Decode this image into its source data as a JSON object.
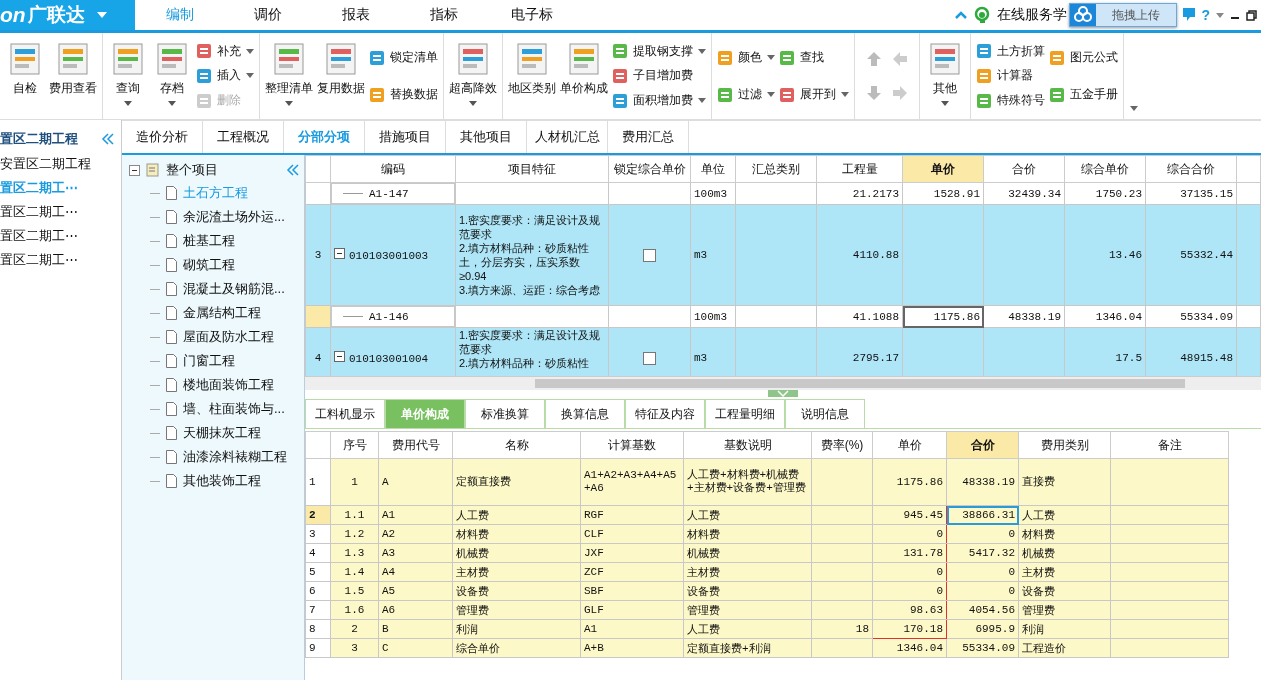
{
  "app_menu": {
    "prefix": "on",
    "brand": "广联达"
  },
  "menu_tabs": [
    {
      "label": "编制",
      "selected": true
    },
    {
      "label": "调价",
      "selected": false
    },
    {
      "label": "报表",
      "selected": false
    },
    {
      "label": "指标",
      "selected": false
    },
    {
      "label": "电子标",
      "selected": false
    }
  ],
  "online_service": "在线服务学",
  "upload_button": "拖拽上传",
  "help": "?",
  "ribbon": [
    {
      "kind": "buttons",
      "items": [
        {
          "kind": "large",
          "label": "自检",
          "dropdown": false,
          "disabled": false
        },
        {
          "kind": "large",
          "label": "费用查看",
          "dropdown": false,
          "disabled": false
        }
      ]
    },
    {
      "kind": "buttons",
      "items": [
        {
          "kind": "large",
          "label": "查询",
          "dropdown": true,
          "disabled": false
        },
        {
          "kind": "large",
          "label": "存档",
          "dropdown": true,
          "disabled": false
        },
        {
          "kind": "stack",
          "items": [
            {
              "label": "补充",
              "dropdown": true,
              "disabled": false
            },
            {
              "label": "插入",
              "dropdown": true,
              "disabled": false
            },
            {
              "label": "删除",
              "dropdown": false,
              "disabled": true
            }
          ]
        }
      ]
    },
    {
      "kind": "buttons",
      "items": [
        {
          "kind": "large",
          "label": "整理清单",
          "dropdown": true,
          "disabled": false
        },
        {
          "kind": "large",
          "label": "复用数据",
          "dropdown": false,
          "disabled": false
        },
        {
          "kind": "stack",
          "items": [
            {
              "label": "锁定清单",
              "dropdown": false,
              "disabled": false
            },
            {
              "label": "替换数据",
              "dropdown": false,
              "disabled": false
            }
          ]
        }
      ]
    },
    {
      "kind": "buttons",
      "items": [
        {
          "kind": "large",
          "label": "超高降效",
          "dropdown": true,
          "disabled": false
        }
      ]
    },
    {
      "kind": "buttons",
      "items": [
        {
          "kind": "large",
          "label": "地区类别",
          "dropdown": false,
          "disabled": false
        },
        {
          "kind": "large",
          "label": "单价构成",
          "dropdown": false,
          "disabled": false
        },
        {
          "kind": "stack",
          "items": [
            {
              "label": "提取钢支撑",
              "dropdown": true,
              "disabled": false
            },
            {
              "label": "子目增加费",
              "dropdown": false,
              "disabled": false
            },
            {
              "label": "面积增加费",
              "dropdown": true,
              "disabled": false
            }
          ]
        }
      ]
    },
    {
      "kind": "buttons",
      "items": [
        {
          "kind": "stack",
          "items": [
            {
              "label": "颜色",
              "dropdown": true,
              "disabled": false
            },
            {
              "label": "过滤",
              "dropdown": true,
              "disabled": false
            }
          ]
        },
        {
          "kind": "stack",
          "items": [
            {
              "label": "查找",
              "dropdown": false,
              "disabled": false
            },
            {
              "label": "展开到",
              "dropdown": true,
              "disabled": false
            }
          ]
        }
      ]
    },
    {
      "kind": "arrows"
    },
    {
      "kind": "buttons",
      "items": [
        {
          "kind": "large",
          "label": "其他",
          "dropdown": true,
          "disabled": false
        }
      ]
    },
    {
      "kind": "buttons",
      "items": [
        {
          "kind": "stack",
          "items": [
            {
              "label": "土方折算",
              "dropdown": false,
              "disabled": false
            },
            {
              "label": "计算器",
              "dropdown": false,
              "disabled": false
            },
            {
              "label": "特殊符号",
              "dropdown": false,
              "disabled": false
            }
          ]
        },
        {
          "kind": "stack",
          "items": [
            {
              "label": "图元公式",
              "dropdown": false,
              "disabled": false
            },
            {
              "label": "五金手册",
              "dropdown": false,
              "disabled": false
            }
          ]
        }
      ]
    }
  ],
  "projects": {
    "title": "置区二期工程",
    "items": [
      {
        "label": "安置区二期工程",
        "selected": false
      },
      {
        "label": "置区二期工⋯",
        "selected": true
      },
      {
        "label": "置区二期工⋯",
        "selected": false
      },
      {
        "label": "置区二期工⋯",
        "selected": false
      },
      {
        "label": "置区二期工⋯",
        "selected": false
      }
    ]
  },
  "main_tabs": [
    {
      "label": "造价分析",
      "selected": false
    },
    {
      "label": "工程概况",
      "selected": false
    },
    {
      "label": "分部分项",
      "selected": true
    },
    {
      "label": "措施项目",
      "selected": false
    },
    {
      "label": "其他项目",
      "selected": false
    },
    {
      "label": "人材机汇总",
      "selected": false
    },
    {
      "label": "费用汇总",
      "selected": false
    }
  ],
  "tree": {
    "label": "整个项目",
    "expanded": true,
    "children": [
      {
        "label": "土石方工程",
        "selected": true
      },
      {
        "label": "余泥渣土场外运...",
        "selected": false
      },
      {
        "label": "桩基工程",
        "selected": false
      },
      {
        "label": "砌筑工程",
        "selected": false
      },
      {
        "label": "混凝土及钢筋混...",
        "selected": false
      },
      {
        "label": "金属结构工程",
        "selected": false
      },
      {
        "label": "屋面及防水工程",
        "selected": false
      },
      {
        "label": "门窗工程",
        "selected": false
      },
      {
        "label": "楼地面装饰工程",
        "selected": false
      },
      {
        "label": "墙、柱面装饰与...",
        "selected": false
      },
      {
        "label": "天棚抹灰工程",
        "selected": false
      },
      {
        "label": "油漆涂料裱糊工程",
        "selected": false
      },
      {
        "label": "其他装饰工程",
        "selected": false
      }
    ]
  },
  "items_table": {
    "columns": [
      {
        "label": "编码",
        "selected": false
      },
      {
        "label": "项目特征",
        "selected": false
      },
      {
        "label": "锁定综合单价",
        "selected": false
      },
      {
        "label": "单位",
        "selected": false
      },
      {
        "label": "汇总类别",
        "selected": false
      },
      {
        "label": "工程量",
        "selected": false
      },
      {
        "label": "单价",
        "selected": true
      },
      {
        "label": "合价",
        "selected": false
      },
      {
        "label": "综合单价",
        "selected": false
      },
      {
        "label": "综合合价",
        "selected": false
      }
    ],
    "rows": [
      {
        "kind": "sub",
        "code": "A1-147",
        "unit": "100m3",
        "quantity": "21.2173",
        "unit_price": "1528.91",
        "total": "32439.34",
        "composite_unit_price": "1750.23",
        "composite_total": "37135.15",
        "selected": false
      },
      {
        "kind": "item",
        "number": "3",
        "expanded": true,
        "code": "010103001003",
        "features": "1.密实度要求：满足设计及规范要求\n2.填方材料品种：砂质粘性土，分层夯实，压实系数≥0.94\n3.填方来源、运距：综合考虑",
        "locked": false,
        "unit": "m3",
        "quantity": "4110.88",
        "composite_unit_price": "13.46",
        "composite_total": "55332.44"
      },
      {
        "kind": "sub",
        "code": "A1-146",
        "unit": "100m3",
        "quantity": "41.1088",
        "unit_price": "1175.86",
        "total": "48338.19",
        "composite_unit_price": "1346.04",
        "composite_total": "55334.09",
        "selected": true
      },
      {
        "kind": "item",
        "number": "4",
        "expanded": true,
        "code": "010103001004",
        "features": "1.密实度要求：满足设计及规范要求\n2.填方材料品种：砂质粘性",
        "locked": false,
        "unit": "m3",
        "quantity": "2795.17",
        "composite_unit_price": "17.5",
        "composite_total": "48915.48"
      }
    ]
  },
  "detail_tabs": [
    {
      "label": "工料机显示",
      "selected": false
    },
    {
      "label": "单价构成",
      "selected": true
    },
    {
      "label": "标准换算",
      "selected": false
    },
    {
      "label": "换算信息",
      "selected": false
    },
    {
      "label": "特征及内容",
      "selected": false
    },
    {
      "label": "工程量明细",
      "selected": false
    },
    {
      "label": "说明信息",
      "selected": false
    }
  ],
  "cost_table": {
    "columns": [
      {
        "label": "序号",
        "selected": false
      },
      {
        "label": "费用代号",
        "selected": false
      },
      {
        "label": "名称",
        "selected": false
      },
      {
        "label": "计算基数",
        "selected": false
      },
      {
        "label": "基数说明",
        "selected": false
      },
      {
        "label": "费率(%)",
        "selected": false
      },
      {
        "label": "单价",
        "selected": false
      },
      {
        "label": "合价",
        "selected": true
      },
      {
        "label": "费用类别",
        "selected": false
      },
      {
        "label": "备注",
        "selected": false
      }
    ],
    "rows": [
      {
        "row": "1",
        "seq": "1",
        "code": "A",
        "name": "定额直接费",
        "base": "A1+A2+A3+A4+A5+A6",
        "base_desc": "人工费+材料费+机械费+主材费+设备费+管理费",
        "unit_price": "1175.86",
        "total": "48338.19",
        "category": "直接费",
        "selected": false,
        "in_range": false
      },
      {
        "row": "2",
        "seq": "1.1",
        "code": "A1",
        "name": "人工费",
        "base": "RGF",
        "base_desc": "人工费",
        "unit_price": "945.45",
        "total": "38866.31",
        "category": "人工费",
        "selected": true,
        "in_range": true
      },
      {
        "row": "3",
        "seq": "1.2",
        "code": "A2",
        "name": "材料费",
        "base": "CLF",
        "base_desc": "材料费",
        "unit_price": "0",
        "total": "0",
        "category": "材料费",
        "selected": false,
        "in_range": true
      },
      {
        "row": "4",
        "seq": "1.3",
        "code": "A3",
        "name": "机械费",
        "base": "JXF",
        "base_desc": "机械费",
        "unit_price": "131.78",
        "total": "5417.32",
        "category": "机械费",
        "selected": false,
        "in_range": true
      },
      {
        "row": "5",
        "seq": "1.4",
        "code": "A4",
        "name": "主材费",
        "base": "ZCF",
        "base_desc": "主材费",
        "unit_price": "0",
        "total": "0",
        "category": "主材费",
        "selected": false,
        "in_range": true
      },
      {
        "row": "6",
        "seq": "1.5",
        "code": "A5",
        "name": "设备费",
        "base": "SBF",
        "base_desc": "设备费",
        "unit_price": "0",
        "total": "0",
        "category": "设备费",
        "selected": false,
        "in_range": true
      },
      {
        "row": "7",
        "seq": "1.6",
        "code": "A6",
        "name": "管理费",
        "base": "GLF",
        "base_desc": "管理费",
        "unit_price": "98.63",
        "total": "4054.56",
        "category": "管理费",
        "selected": false,
        "in_range": true
      },
      {
        "row": "8",
        "seq": "2",
        "code": "B",
        "name": "利润",
        "base": "A1",
        "base_desc": "人工费",
        "rate": "18",
        "unit_price": "170.18",
        "total": "6995.9",
        "category": "利润",
        "selected": false,
        "in_range": true
      },
      {
        "row": "9",
        "seq": "3",
        "code": "C",
        "name": "综合单价",
        "base": "A+B",
        "base_desc": "定额直接费+利润",
        "unit_price": "1346.04",
        "total": "55334.09",
        "category": "工程造价",
        "selected": false,
        "in_range": false
      }
    ]
  }
}
